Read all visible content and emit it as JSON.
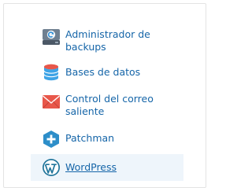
{
  "menu": {
    "items": [
      {
        "line1": "Administrador de",
        "line2": "backups",
        "icon": "backup-manager-icon"
      },
      {
        "line1": "Bases de datos",
        "line2": "",
        "icon": "database-icon"
      },
      {
        "line1": "Control del correo",
        "line2": "saliente",
        "icon": "mail-icon"
      },
      {
        "line1": "Patchman",
        "line2": "",
        "icon": "patchman-icon"
      },
      {
        "line1": "WordPress",
        "line2": "",
        "icon": "wordpress-icon",
        "active": true
      }
    ]
  },
  "colors": {
    "link": "#1565a8",
    "active_bg": "#eef5fb",
    "db": "#3da3e6",
    "mail": "#e8574a",
    "patchman": "#2d8ec9",
    "wordpress": "#21759b"
  }
}
